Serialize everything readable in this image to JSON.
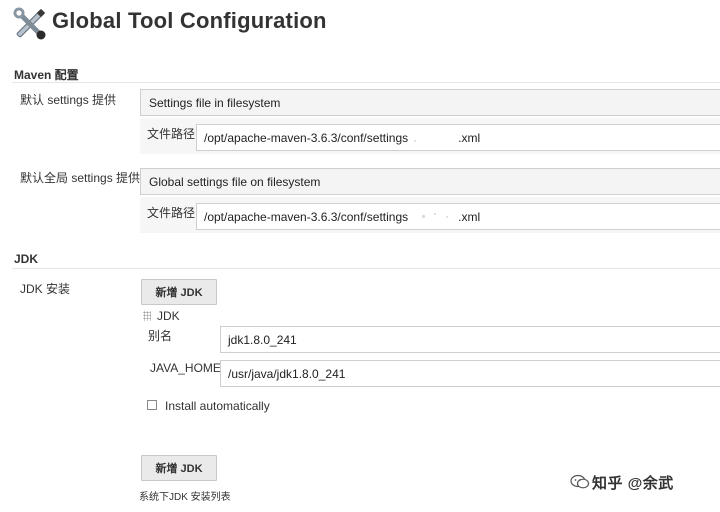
{
  "header": {
    "title": "Global Tool Configuration",
    "icon": "wrench-screwdriver-icon"
  },
  "maven": {
    "section_title": "Maven 配置",
    "settings": {
      "label": "默认 settings 提供",
      "selected": "Settings file in filesystem",
      "path_label": "文件路径",
      "path_value_start": "/opt/apache-maven-3.6.3/conf/settings",
      "path_value_end": ".xml"
    },
    "global_settings": {
      "label": "默认全局 settings 提供",
      "selected": "Global settings file on filesystem",
      "path_label": "文件路径",
      "path_value_start": "/opt/apache-maven-3.6.3/conf/settings",
      "path_value_end": ".xml"
    }
  },
  "jdk": {
    "section_title": "JDK",
    "install_label": "JDK 安装",
    "add_button": "新增 JDK",
    "entry": {
      "header": "JDK",
      "alias_label": "别名",
      "alias_value": "jdk1.8.0_241",
      "java_home_label": "JAVA_HOME",
      "java_home_value": "/usr/java/jdk1.8.0_241",
      "install_auto_label": "Install automatically",
      "install_auto_checked": false
    },
    "add_button_bottom": "新增 JDK",
    "footer_note": "系统下JDK 安装列表"
  },
  "watermark": {
    "text": "知乎 @余武",
    "icon": "wechat-icon"
  }
}
